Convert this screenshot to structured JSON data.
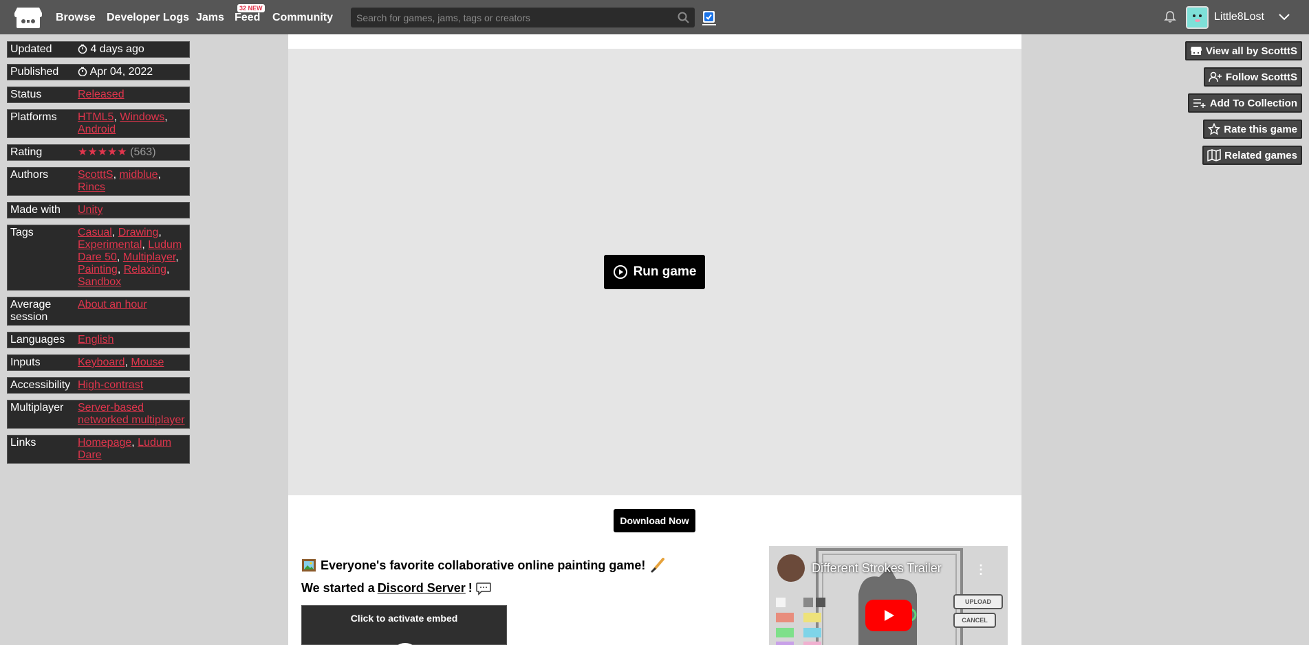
{
  "nav": {
    "browse": "Browse",
    "devlogs": "Developer Logs",
    "jams": "Jams",
    "feed": "Feed",
    "feed_badge": "32 NEW",
    "community": "Community",
    "search_placeholder": "Search for games, jams, tags or creators",
    "username": "Little8Lost"
  },
  "info": {
    "updated": {
      "key": "Updated",
      "value": "4 days ago"
    },
    "published": {
      "key": "Published",
      "value": "Apr 04, 2022"
    },
    "status": {
      "key": "Status",
      "value": "Released"
    },
    "platforms": {
      "key": "Platforms",
      "items": [
        "HTML5",
        "Windows",
        "Android"
      ]
    },
    "rating": {
      "key": "Rating",
      "stars": 5,
      "count": "(563)"
    },
    "authors": {
      "key": "Authors",
      "items": [
        "ScotttS",
        "midblue",
        "Rincs"
      ]
    },
    "made_with": {
      "key": "Made with",
      "value": "Unity"
    },
    "tags": {
      "key": "Tags",
      "items": [
        "Casual",
        "Drawing",
        "Experimental",
        "Ludum Dare 50",
        "Multiplayer",
        "Painting",
        "Relaxing",
        "Sandbox"
      ]
    },
    "avg_session": {
      "key": "Average session",
      "value": "About an hour"
    },
    "languages": {
      "key": "Languages",
      "value": "English"
    },
    "inputs": {
      "key": "Inputs",
      "items": [
        "Keyboard",
        "Mouse"
      ]
    },
    "accessibility": {
      "key": "Accessibility",
      "value": "High-contrast"
    },
    "multiplayer": {
      "key": "Multiplayer",
      "value": "Server-based networked multiplayer"
    },
    "links": {
      "key": "Links",
      "items": [
        "Homepage",
        "Ludum Dare"
      ]
    }
  },
  "game": {
    "run_label": "Run game",
    "download_label": "Download Now",
    "desc_line1": "Everyone's favorite collaborative online painting game!",
    "desc_line2_pre": "We started a",
    "desc_line2_link": "Discord Server",
    "desc_line2_post": "!",
    "embed_label": "Click to activate embed",
    "video_title": "Different Strokes Trailer",
    "video_upload": "UPLOAD",
    "video_cancel": "CANCEL"
  },
  "right": {
    "view_all": "View all by ScotttS",
    "follow": "Follow ScotttS",
    "add_collection": "Add To Collection",
    "rate": "Rate this game",
    "related": "Related games"
  },
  "colors": {
    "accent": "#e0354c",
    "nav_bg": "#565656",
    "panel_bg": "#2a2a2a"
  }
}
